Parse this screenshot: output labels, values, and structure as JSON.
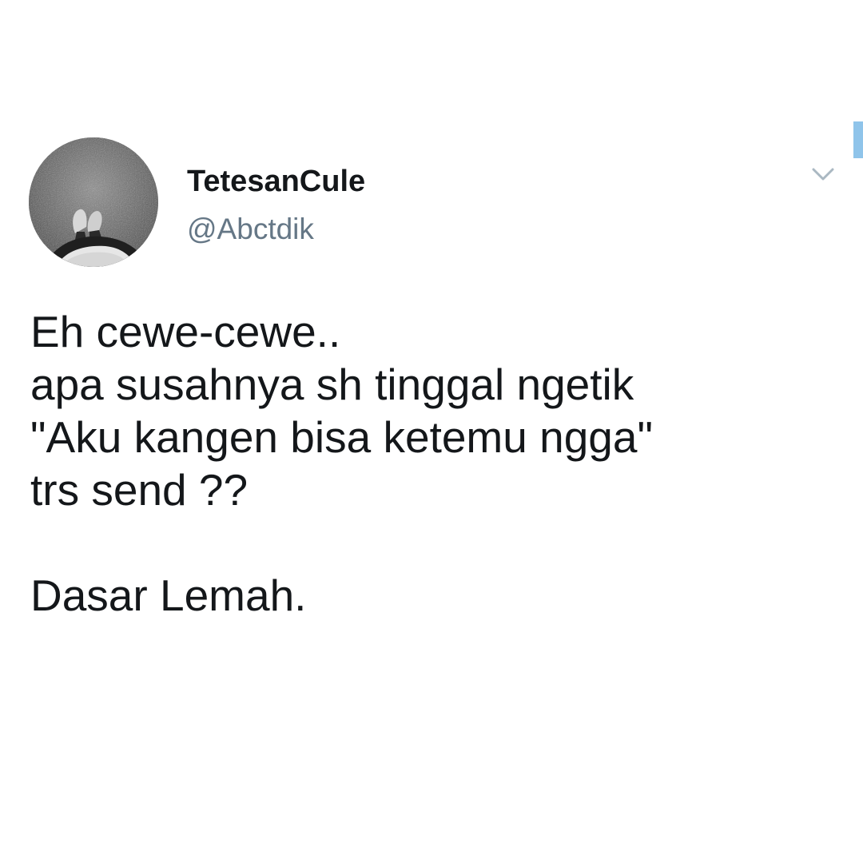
{
  "tweet": {
    "display_name": "TetesanCule",
    "handle": "@Abctdik",
    "text": "Eh cewe-cewe..\napa susahnya sh tinggal ngetik\n\"Aku kangen bisa ketemu ngga\"\ntrs send ??\n\nDasar Lemah.",
    "menu_icon": "chevron-down-icon"
  },
  "colors": {
    "name": "#14171a",
    "handle": "#657786",
    "caret": "#aab8c2",
    "scroll_indicator": "#8fc4ea",
    "background": "#ffffff"
  }
}
